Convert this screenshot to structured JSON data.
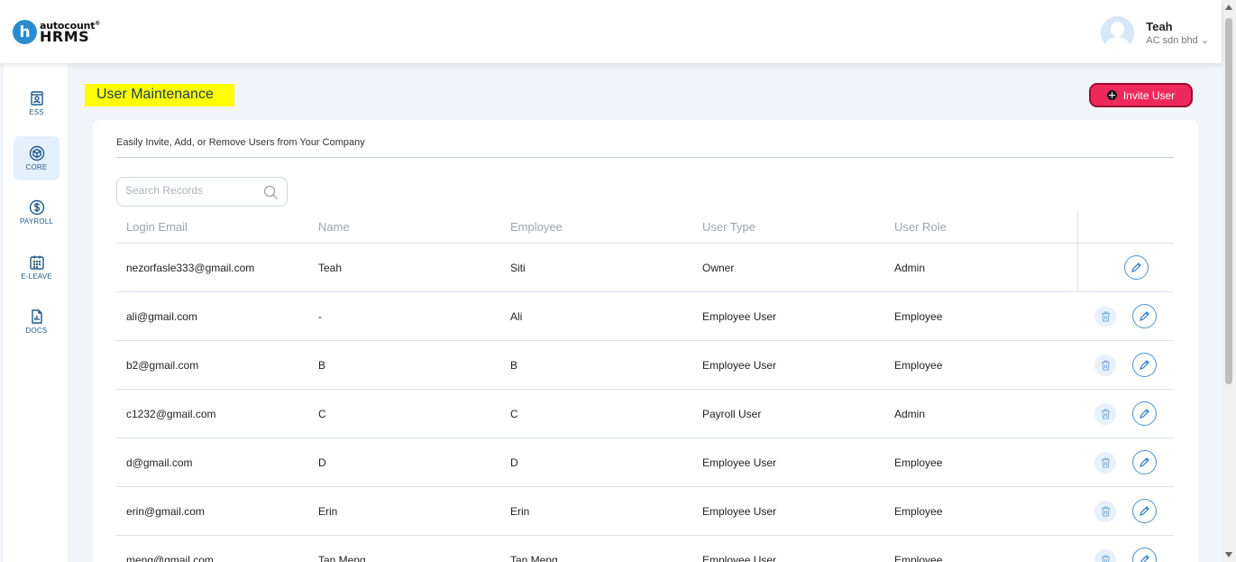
{
  "brand": {
    "top": "autocount",
    "mark": "®",
    "name": "HRMS",
    "letter": "h"
  },
  "user": {
    "name": "Teah",
    "company": "AC sdn bhd",
    "caret": "⌄"
  },
  "sidebar": {
    "items": [
      {
        "label": "ESS",
        "icon": "id-card-icon"
      },
      {
        "label": "CORE",
        "icon": "cube-icon",
        "active": true
      },
      {
        "label": "PAYROLL",
        "icon": "dollar-icon"
      },
      {
        "label": "E-LEAVE",
        "icon": "calendar-icon"
      },
      {
        "label": "DOCS",
        "icon": "document-icon"
      }
    ]
  },
  "page": {
    "title": "User Maintenance",
    "invite_label": "Invite User",
    "description": "Easily Invite, Add, or Remove Users from Your Company"
  },
  "search": {
    "placeholder": "Search Records",
    "value": ""
  },
  "table": {
    "columns": [
      "Login Email",
      "Name",
      "Employee",
      "User Type",
      "User Role"
    ],
    "rows": [
      {
        "email": "nezorfasle333@gmail.com",
        "name": "Teah",
        "employee": "Siti",
        "type": "Owner",
        "role": "Admin"
      },
      {
        "email": "ali@gmail.com",
        "name": "-",
        "employee": "Ali",
        "type": "Employee User",
        "role": "Employee"
      },
      {
        "email": "b2@gmail.com",
        "name": "B",
        "employee": "B",
        "type": "Employee User",
        "role": "Employee"
      },
      {
        "email": "c1232@gmail.com",
        "name": "C",
        "employee": "C",
        "type": "Payroll User",
        "role": "Admin"
      },
      {
        "email": "d@gmail.com",
        "name": "D",
        "employee": "D",
        "type": "Employee User",
        "role": "Employee"
      },
      {
        "email": "erin@gmail.com",
        "name": "Erin",
        "employee": "Erin",
        "type": "Employee User",
        "role": "Employee"
      },
      {
        "email": "meng@gmail.com",
        "name": "Tan Meng",
        "employee": "Tan Meng",
        "type": "Employee User",
        "role": "Employee"
      }
    ]
  },
  "colors": {
    "accent": "#ee2a5c",
    "highlight": "#ffff00",
    "icon_blue": "#1e5a8a"
  }
}
